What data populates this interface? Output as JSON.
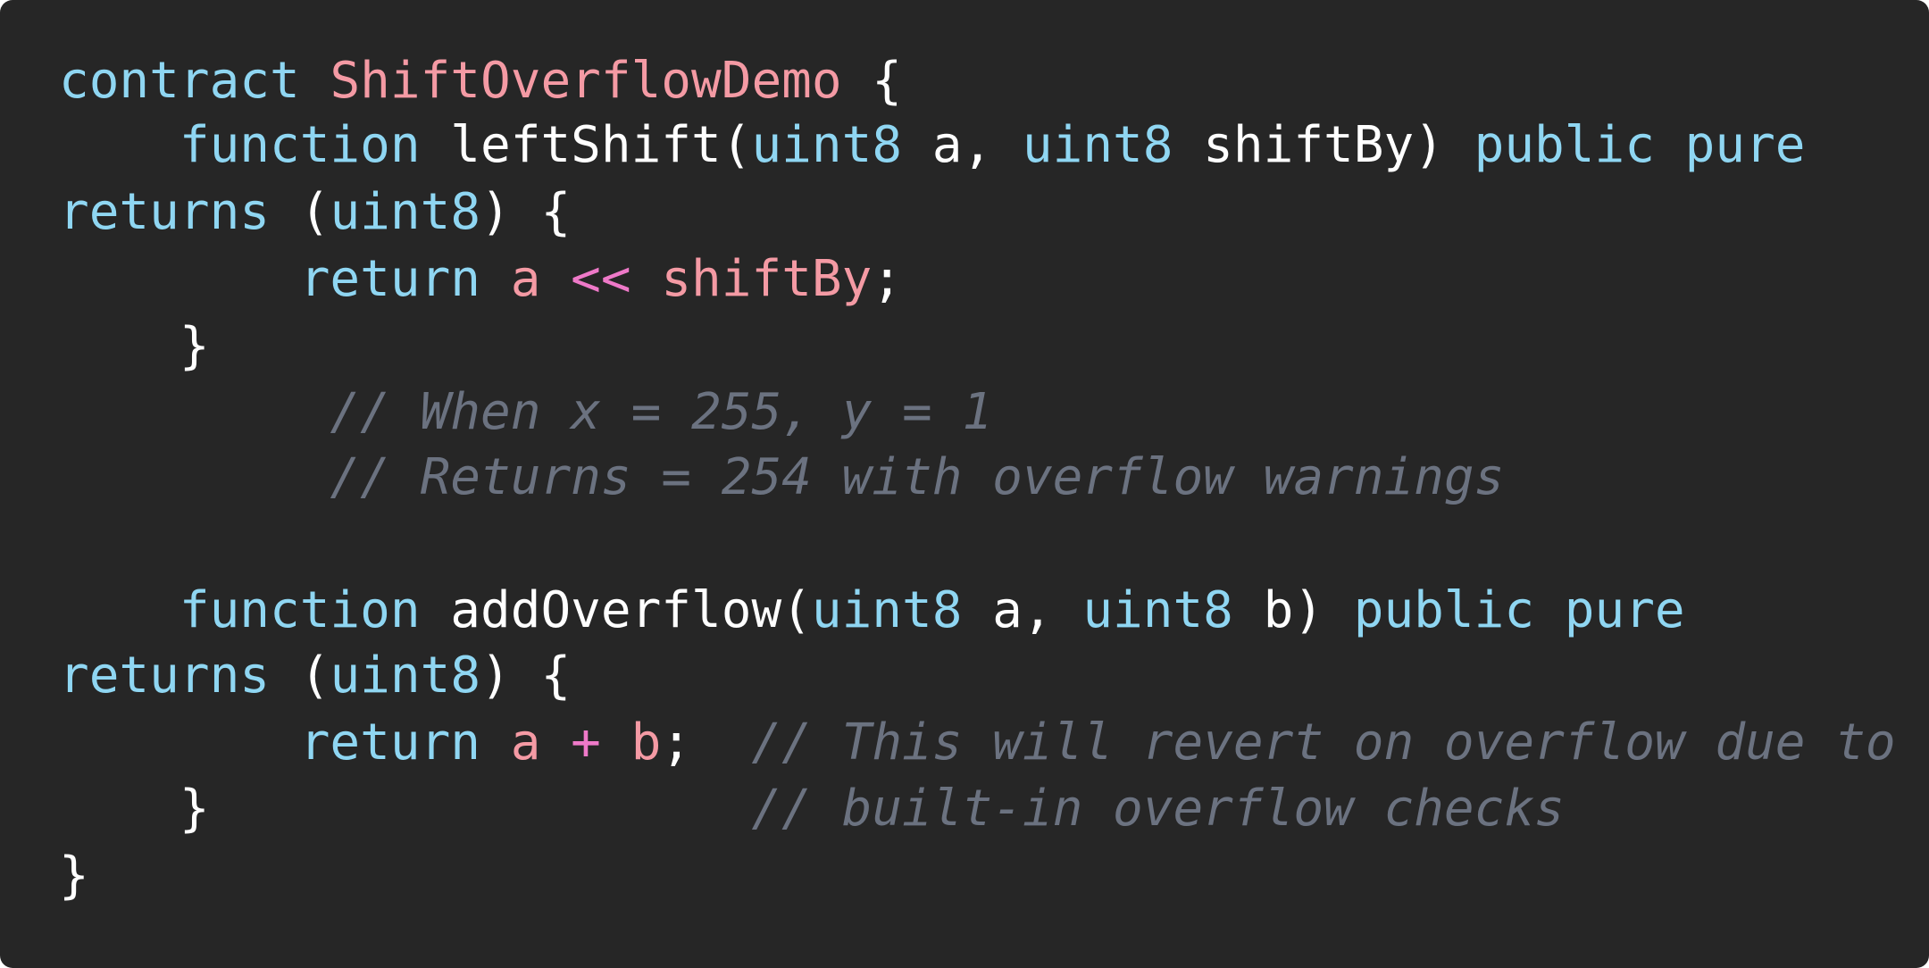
{
  "editor": {
    "background": "#262626",
    "colors": {
      "keyword": "#8fd6f2",
      "identifier_highlight": "#f49aa4",
      "operator": "#ee79c8",
      "text": "#ffffff",
      "comment": "#6b7280"
    },
    "lines": [
      [
        {
          "t": "contract",
          "c": "kw"
        },
        {
          "t": " ",
          "c": "plain"
        },
        {
          "t": "ShiftOverflowDemo",
          "c": "name"
        },
        {
          "t": " {",
          "c": "plain"
        }
      ],
      [
        {
          "t": "    ",
          "c": "plain"
        },
        {
          "t": "function",
          "c": "kw"
        },
        {
          "t": " leftShift(",
          "c": "plain"
        },
        {
          "t": "uint8",
          "c": "kw"
        },
        {
          "t": " a, ",
          "c": "plain"
        },
        {
          "t": "uint8",
          "c": "kw"
        },
        {
          "t": " shiftBy) ",
          "c": "plain"
        },
        {
          "t": "public",
          "c": "kw"
        },
        {
          "t": " ",
          "c": "plain"
        },
        {
          "t": "pure",
          "c": "kw"
        }
      ],
      [
        {
          "t": "returns",
          "c": "kw"
        },
        {
          "t": " (",
          "c": "plain"
        },
        {
          "t": "uint8",
          "c": "kw"
        },
        {
          "t": ") {",
          "c": "plain"
        }
      ],
      [
        {
          "t": "        ",
          "c": "plain"
        },
        {
          "t": "return",
          "c": "kw"
        },
        {
          "t": " ",
          "c": "plain"
        },
        {
          "t": "a",
          "c": "id"
        },
        {
          "t": " ",
          "c": "plain"
        },
        {
          "t": "<<",
          "c": "op"
        },
        {
          "t": " ",
          "c": "plain"
        },
        {
          "t": "shiftBy",
          "c": "id"
        },
        {
          "t": ";",
          "c": "plain"
        }
      ],
      [
        {
          "t": "    }",
          "c": "plain"
        }
      ],
      [
        {
          "t": "         ",
          "c": "plain"
        },
        {
          "t": "// When x = 255, y = 1",
          "c": "cmt"
        }
      ],
      [
        {
          "t": "         ",
          "c": "plain"
        },
        {
          "t": "// Returns = 254 with overflow warnings",
          "c": "cmt"
        }
      ],
      [
        {
          "t": "",
          "c": "plain"
        }
      ],
      [
        {
          "t": "    ",
          "c": "plain"
        },
        {
          "t": "function",
          "c": "kw"
        },
        {
          "t": " addOverflow(",
          "c": "plain"
        },
        {
          "t": "uint8",
          "c": "kw"
        },
        {
          "t": " a, ",
          "c": "plain"
        },
        {
          "t": "uint8",
          "c": "kw"
        },
        {
          "t": " b) ",
          "c": "plain"
        },
        {
          "t": "public",
          "c": "kw"
        },
        {
          "t": " ",
          "c": "plain"
        },
        {
          "t": "pure",
          "c": "kw"
        }
      ],
      [
        {
          "t": "returns",
          "c": "kw"
        },
        {
          "t": " (",
          "c": "plain"
        },
        {
          "t": "uint8",
          "c": "kw"
        },
        {
          "t": ") {",
          "c": "plain"
        }
      ],
      [
        {
          "t": "        ",
          "c": "plain"
        },
        {
          "t": "return",
          "c": "kw"
        },
        {
          "t": " ",
          "c": "plain"
        },
        {
          "t": "a",
          "c": "id"
        },
        {
          "t": " ",
          "c": "plain"
        },
        {
          "t": "+",
          "c": "op"
        },
        {
          "t": " ",
          "c": "plain"
        },
        {
          "t": "b",
          "c": "id"
        },
        {
          "t": ";  ",
          "c": "plain"
        },
        {
          "t": "// This will revert on overflow due to",
          "c": "cmt"
        }
      ],
      [
        {
          "t": "    }",
          "c": "plain"
        },
        {
          "t": "                  ",
          "c": "plain"
        },
        {
          "t": "// built-in overflow checks",
          "c": "cmt"
        }
      ],
      [
        {
          "t": "}",
          "c": "plain"
        }
      ]
    ]
  }
}
